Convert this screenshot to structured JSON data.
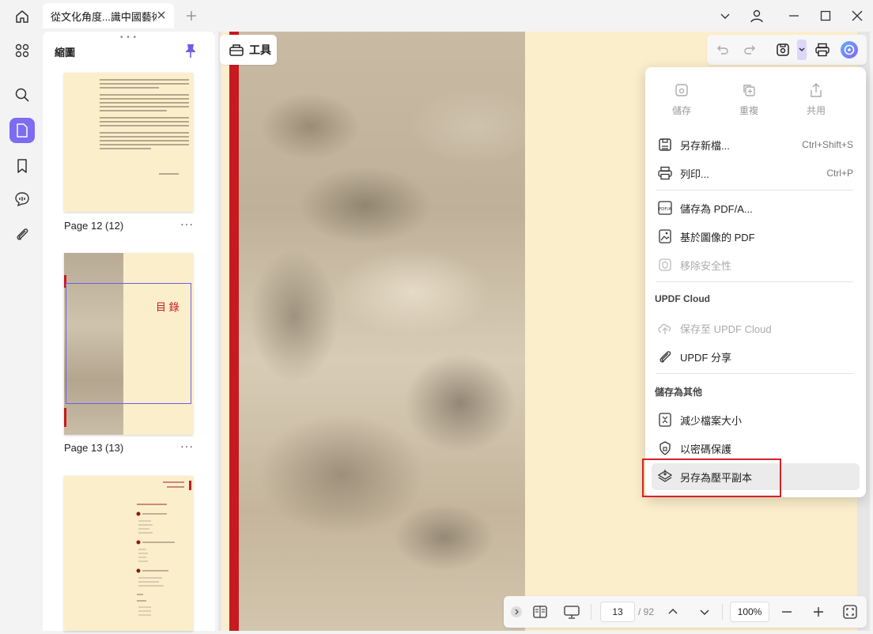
{
  "titlebar": {
    "tab_title": "從文化角度...識中國藝術"
  },
  "sidebar": {
    "title": "縮圖",
    "thumbnails": [
      {
        "label": "Page 12 (12)"
      },
      {
        "label": "Page 13 (13)",
        "heading": "目 錄"
      },
      {
        "label": ""
      }
    ]
  },
  "toolbar": {
    "tools_label": "工具"
  },
  "menu": {
    "top_actions": [
      {
        "label": "儲存",
        "icon": "save-icon"
      },
      {
        "label": "重複",
        "icon": "duplicate-icon"
      },
      {
        "label": "共用",
        "icon": "share-icon"
      }
    ],
    "items": [
      {
        "label": "另存新檔...",
        "shortcut": "Ctrl+Shift+S",
        "icon": "save-as-icon"
      },
      {
        "label": "列印...",
        "shortcut": "Ctrl+P",
        "icon": "printer-icon"
      },
      {
        "label": "儲存為 PDF/A...",
        "icon": "pdfa-icon"
      },
      {
        "label": "基於圖像的 PDF",
        "icon": "image-pdf-icon"
      },
      {
        "label": "移除安全性",
        "icon": "remove-security-icon",
        "disabled": true
      }
    ],
    "cloud_section": "UPDF Cloud",
    "cloud_items": [
      {
        "label": "保存至 UPDF Cloud",
        "icon": "cloud-upload-icon",
        "disabled": true
      },
      {
        "label": "UPDF 分享",
        "icon": "link-icon"
      }
    ],
    "other_section": "儲存為其他",
    "other_items": [
      {
        "label": "減少檔案大小",
        "icon": "compress-icon"
      },
      {
        "label": "以密碼保護",
        "icon": "password-icon"
      },
      {
        "label": "另存為壓平副本",
        "icon": "flatten-icon"
      }
    ]
  },
  "bottom": {
    "page_current": "13",
    "page_total": "/ 92",
    "zoom": "100%"
  },
  "colors": {
    "accent": "#7d6cf0",
    "highlight": "#d2232a",
    "page_bg": "#fbeecb",
    "red_bar": "#c8191e"
  }
}
